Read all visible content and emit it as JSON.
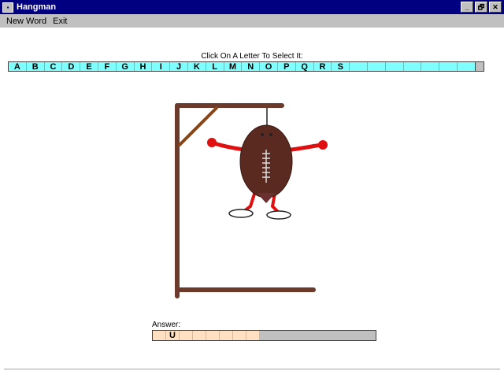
{
  "window": {
    "title": "Hangman"
  },
  "window_buttons": [
    "_",
    "🗗",
    "✕"
  ],
  "menu": [
    {
      "label": "New Word"
    },
    {
      "label": "Exit"
    }
  ],
  "instruction": "Click On A Letter To Select It:",
  "letters": [
    "A",
    "B",
    "C",
    "D",
    "E",
    "F",
    "G",
    "H",
    "I",
    "J",
    "K",
    "L",
    "M",
    "N",
    "O",
    "P",
    "Q",
    "R",
    "S",
    "",
    "",
    "",
    "",
    "",
    "",
    ""
  ],
  "answer": {
    "label": "Answer:",
    "cells": [
      "",
      "U",
      "",
      "",
      "",
      "",
      "",
      ""
    ]
  },
  "colors": {
    "titlebar": "#000080",
    "letter_bar": "#80ffff",
    "answer_cells": "#ffe0c0",
    "gallows": "#6b3a2a",
    "brace": "#8b4513",
    "body": "#5a2a20",
    "limbs": "#e01010"
  }
}
